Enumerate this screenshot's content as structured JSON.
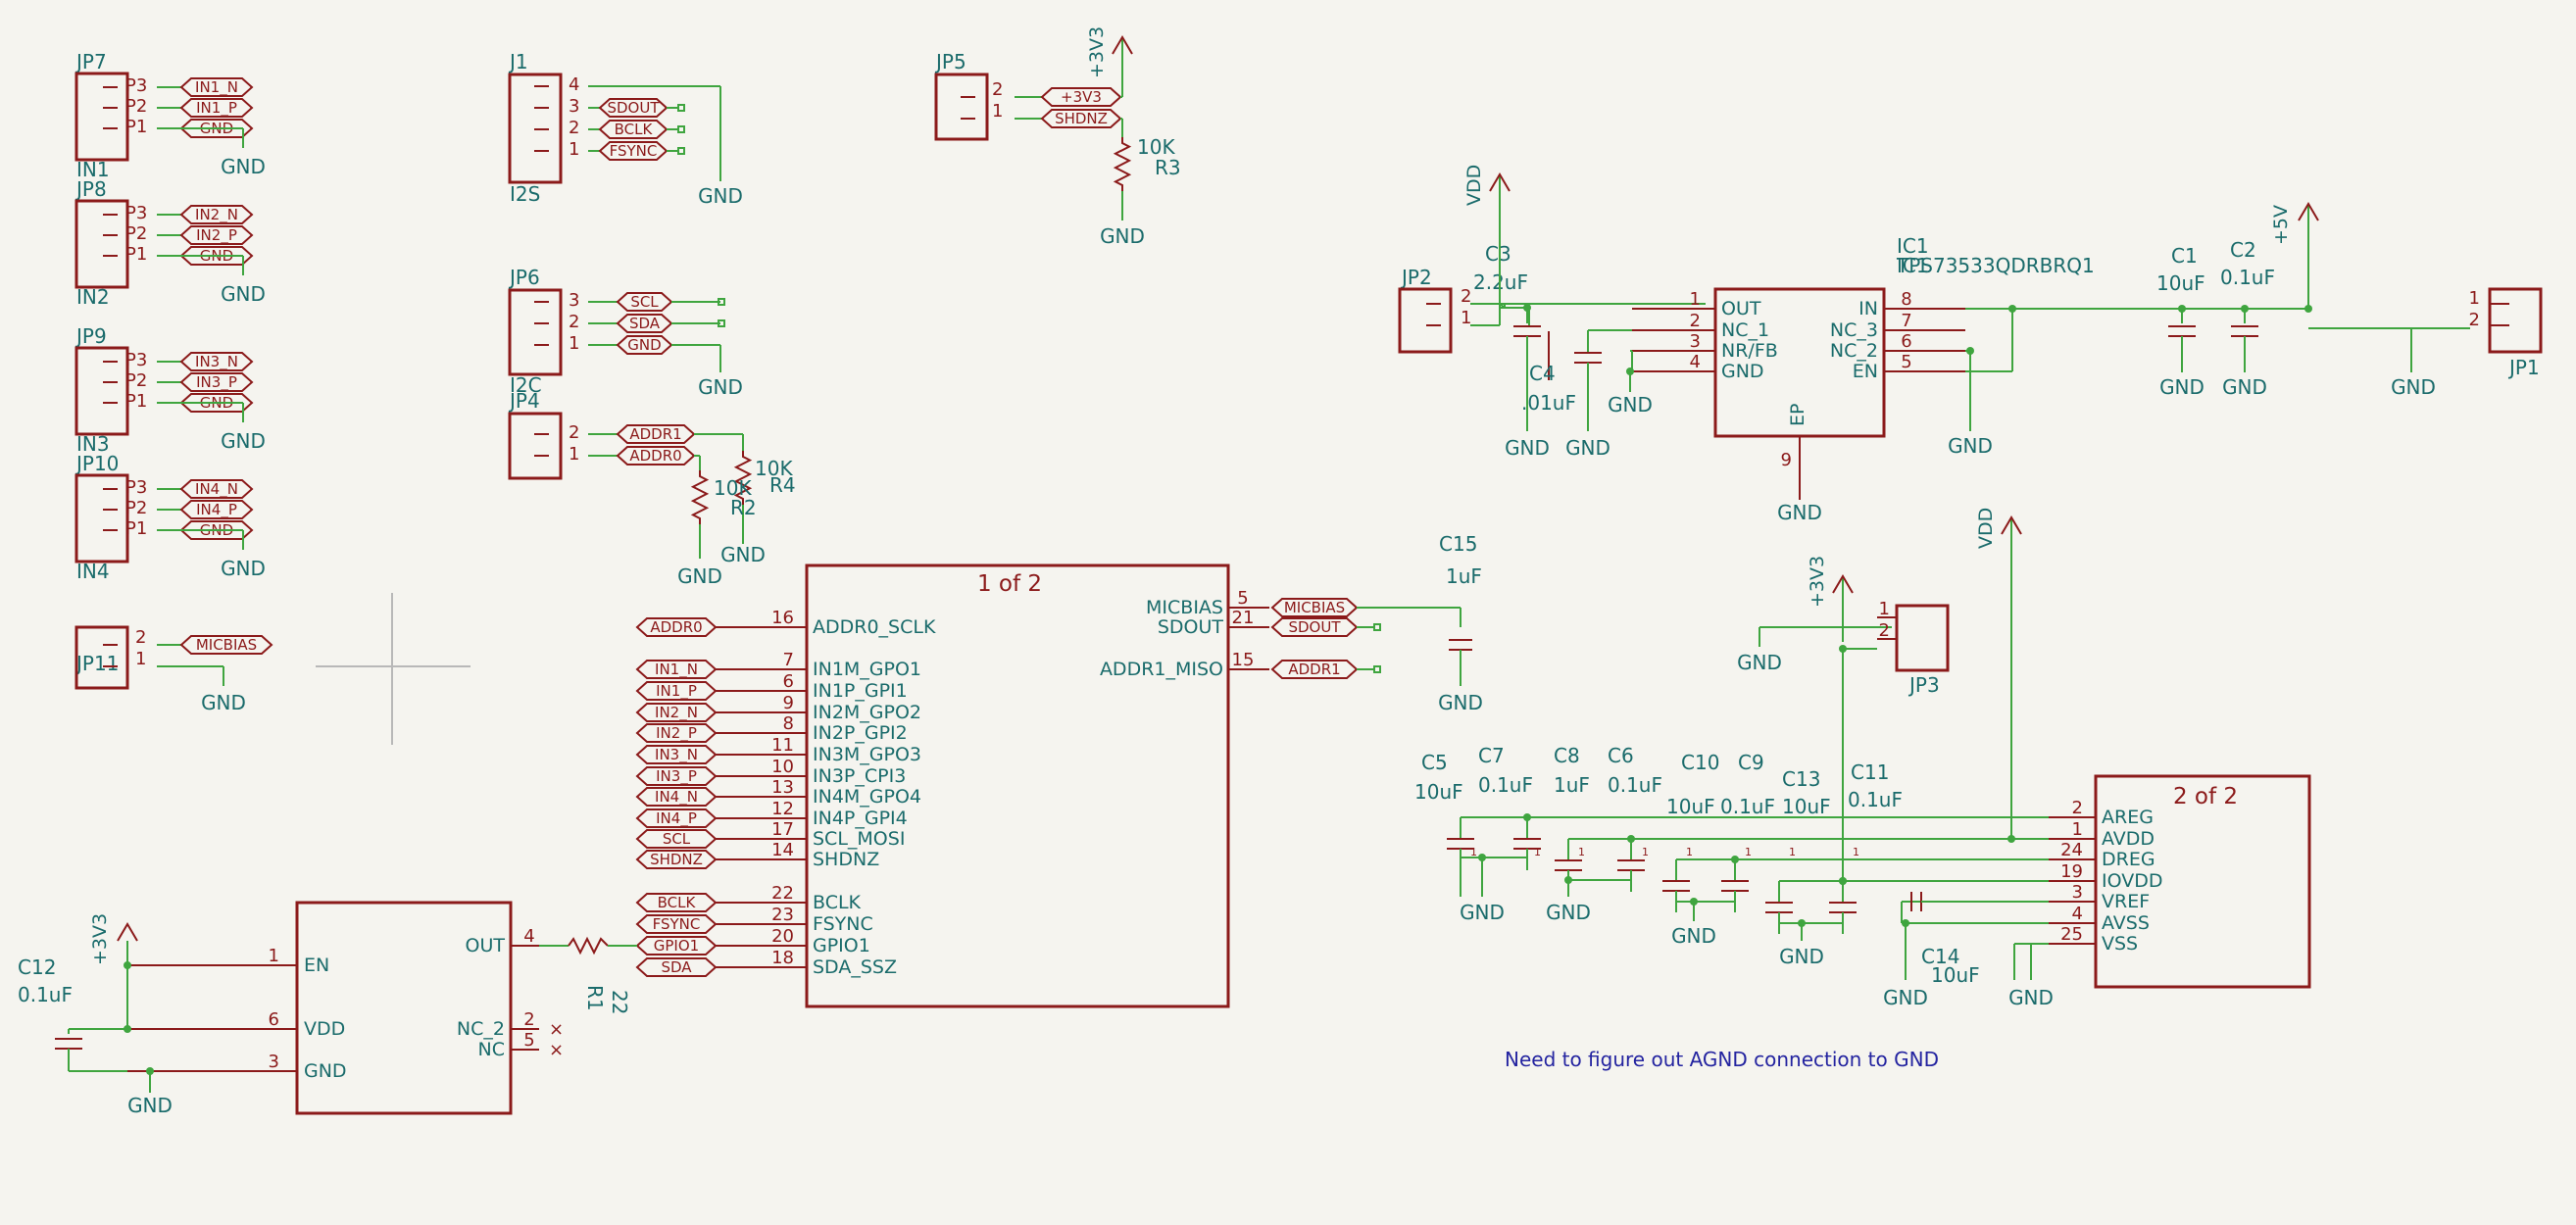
{
  "connectors": [
    {
      "ref": "JP7",
      "value": "IN1",
      "pins": [
        "P3",
        "P2",
        "P1"
      ],
      "labels": [
        "IN1_N",
        "IN1_P",
        "GND"
      ],
      "gnd": "GND"
    },
    {
      "ref": "JP8",
      "value": "IN2",
      "pins": [
        "P3",
        "P2",
        "P1"
      ],
      "labels": [
        "IN2_N",
        "IN2_P",
        "GND"
      ],
      "gnd": "GND"
    },
    {
      "ref": "JP9",
      "value": "IN3",
      "pins": [
        "P3",
        "P2",
        "P1"
      ],
      "labels": [
        "IN3_N",
        "IN3_P",
        "GND"
      ],
      "gnd": "GND"
    },
    {
      "ref": "JP10",
      "value": "IN4",
      "pins": [
        "P3",
        "P2",
        "P1"
      ],
      "labels": [
        "IN4_N",
        "IN4_P",
        "GND"
      ],
      "gnd": "GND"
    }
  ],
  "jp11": {
    "ref": "JP11",
    "pins": [
      "2",
      "1"
    ],
    "label": "MICBIAS",
    "gnd": "GND"
  },
  "j1": {
    "ref": "J1",
    "value": "I2S",
    "pins": [
      "4",
      "3",
      "2",
      "1"
    ],
    "labels": [
      "SDOUT",
      "BCLK",
      "FSYNC"
    ],
    "gnd": "GND"
  },
  "jp6": {
    "ref": "JP6",
    "value": "I2C",
    "pins": [
      "3",
      "2",
      "1"
    ],
    "labels": [
      "SCL",
      "SDA",
      "GND"
    ],
    "gnd": "GND"
  },
  "jp4": {
    "ref": "JP4",
    "pins": [
      "2",
      "1"
    ],
    "labels": [
      "ADDR1",
      "ADDR0"
    ]
  },
  "r2": {
    "ref": "R2",
    "value": "10K",
    "gnd": "GND"
  },
  "r4": {
    "ref": "R4",
    "value": "10K",
    "gnd": "GND"
  },
  "jp5": {
    "ref": "JP5",
    "pins": [
      "2",
      "1"
    ],
    "labels": [
      "+3V3",
      "SHDNZ"
    ],
    "pwr": "+3V3"
  },
  "r3": {
    "ref": "R3",
    "value": "10K",
    "gnd": "GND"
  },
  "u1": {
    "unit": "1 of 2",
    "left_pins": [
      {
        "label": "ADDR0",
        "num": "16",
        "name": "ADDR0_SCLK"
      },
      {
        "label": "IN1_N",
        "num": "7",
        "name": "IN1M_GPO1"
      },
      {
        "label": "IN1_P",
        "num": "6",
        "name": "IN1P_GPI1"
      },
      {
        "label": "IN2_N",
        "num": "9",
        "name": "IN2M_GPO2"
      },
      {
        "label": "IN2_P",
        "num": "8",
        "name": "IN2P_GPI2"
      },
      {
        "label": "IN3_N",
        "num": "11",
        "name": "IN3M_GPO3"
      },
      {
        "label": "IN3_P",
        "num": "10",
        "name": "IN3P_CPI3"
      },
      {
        "label": "IN4_N",
        "num": "13",
        "name": "IN4M_GPO4"
      },
      {
        "label": "IN4_P",
        "num": "12",
        "name": "IN4P_GPI4"
      },
      {
        "label": "SCL",
        "num": "17",
        "name": "SCL_MOSI"
      },
      {
        "label": "SHDNZ",
        "num": "14",
        "name": "SHDNZ"
      },
      {
        "label": "BCLK",
        "num": "22",
        "name": "BCLK"
      },
      {
        "label": "FSYNC",
        "num": "23",
        "name": "FSYNC"
      },
      {
        "label": "GPIO1",
        "num": "20",
        "name": "GPIO1"
      },
      {
        "label": "SDA",
        "num": "18",
        "name": "SDA_SSZ"
      }
    ],
    "right_pins": [
      {
        "name": "MICBIAS",
        "num": "5",
        "label": "MICBIAS"
      },
      {
        "name": "SDOUT",
        "num": "21",
        "label": "SDOUT"
      },
      {
        "name": "ADDR1_MISO",
        "num": "15",
        "label": "ADDR1"
      }
    ]
  },
  "c15": {
    "ref": "C15",
    "value": "1uF",
    "gnd": "GND"
  },
  "osc": {
    "left_pins": [
      {
        "num": "1",
        "name": "EN"
      },
      {
        "num": "6",
        "name": "VDD"
      },
      {
        "num": "3",
        "name": "GND"
      }
    ],
    "right_pins": [
      {
        "num": "4",
        "name": "OUT"
      },
      {
        "num": "2",
        "name": "NC_2"
      },
      {
        "num": "5",
        "name": "NC"
      }
    ],
    "pwr": "+3V3",
    "gnd": "GND"
  },
  "c12": {
    "ref": "C12",
    "value": "0.1uF"
  },
  "r1": {
    "ref": "R1",
    "value": "22"
  },
  "jp2": {
    "ref": "JP2",
    "pins": [
      "2",
      "1"
    ]
  },
  "c3": {
    "ref": "C3",
    "value": "2.2uF",
    "gnd": "GND"
  },
  "c4": {
    "ref": "C4",
    "value": ".01uF",
    "gnd": "GND"
  },
  "vdd_top": "VDD",
  "ic1": {
    "ref": "IC1",
    "value": "TPS73533QDRBRQ1",
    "left_pins": [
      {
        "num": "1",
        "name": "OUT"
      },
      {
        "num": "2",
        "name": "NC_1"
      },
      {
        "num": "3",
        "name": "NR/FB"
      },
      {
        "num": "4",
        "name": "GND"
      }
    ],
    "right_pins": [
      {
        "num": "8",
        "name": "IN"
      },
      {
        "num": "7",
        "name": "NC_3"
      },
      {
        "num": "6",
        "name": "NC_2"
      },
      {
        "num": "5",
        "name": "EN"
      }
    ],
    "ep_name": "EP",
    "ep_num": "9",
    "gnd": "GND"
  },
  "c1": {
    "ref": "C1",
    "value": "10uF",
    "gnd": "GND"
  },
  "c2": {
    "ref": "C2",
    "value": "0.1uF",
    "gnd": "GND"
  },
  "p5v": "+5V",
  "jp1": {
    "ref": "JP1",
    "pins": [
      "1",
      "2"
    ],
    "gnd": "GND"
  },
  "jp3": {
    "ref": "JP3",
    "pins": [
      "1",
      "2"
    ],
    "gnd": "GND",
    "pwr": "+3V3"
  },
  "vdd_mid": "VDD",
  "u2": {
    "unit": "2 of 2",
    "pins": [
      {
        "num": "2",
        "name": "AREG"
      },
      {
        "num": "1",
        "name": "AVDD"
      },
      {
        "num": "24",
        "name": "DREG"
      },
      {
        "num": "19",
        "name": "IOVDD"
      },
      {
        "num": "3",
        "name": "VREF"
      },
      {
        "num": "4",
        "name": "AVSS"
      },
      {
        "num": "25",
        "name": "VSS"
      }
    ]
  },
  "caps_bottom": [
    {
      "ref": "C5",
      "value": "10uF"
    },
    {
      "ref": "C7",
      "value": "0.1uF"
    },
    {
      "ref": "C8",
      "value": "1uF"
    },
    {
      "ref": "C6",
      "value": "0.1uF"
    },
    {
      "ref": "C10",
      "value": "10uF"
    },
    {
      "ref": "C9",
      "value": "0.1uF"
    },
    {
      "ref": "C13",
      "value": "10uF"
    },
    {
      "ref": "C11",
      "value": "0.1uF"
    },
    {
      "ref": "C14",
      "value": "10uF"
    }
  ],
  "gnd_label": "GND",
  "cap_pins": [
    "1",
    "2"
  ],
  "note": "Need to figure out AGND connection to GND"
}
